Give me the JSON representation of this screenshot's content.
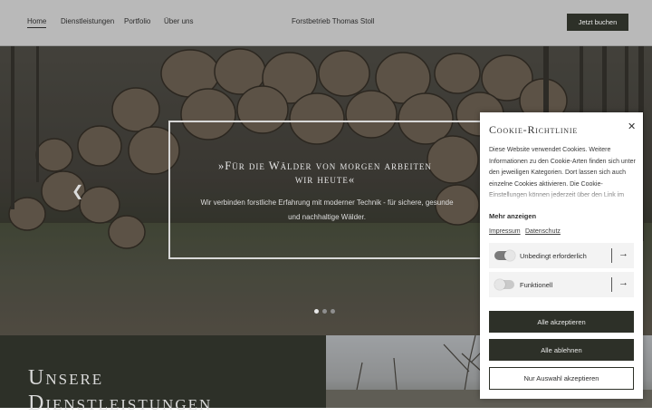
{
  "header": {
    "nav": [
      "Home",
      "Dienstleistungen",
      "Portfolio",
      "Über uns"
    ],
    "brand": "Forstbetrieb Thomas Stoll",
    "book_button": "Jetzt buchen"
  },
  "hero": {
    "quote_title_line1": "»Für die Wälder von morgen arbeiten",
    "quote_title_line2": "wir heute«",
    "quote_text": "Wir verbinden forstliche Erfahrung mit moderner Technik - für sichere, gesunde und nachhaltige Wälder.",
    "prev_icon": "chevron-left-icon",
    "slides_total": 3,
    "slide_active": 1
  },
  "services": {
    "heading_line1": "Unsere",
    "heading_line2": "Dienstleistungen"
  },
  "cookie": {
    "title": "Cookie-Richtlinie",
    "close_icon": "close-icon",
    "body": "Diese Website verwendet Cookies. Weitere Informationen zu den Cookie-Arten finden sich unter den jeweiligen Kategorien. Dort lassen sich auch einzelne Cookies aktivieren. Die Cookie-Einstellungen können jederzeit über den Link im Footer dieser",
    "show_more": "Mehr anzeigen",
    "links": [
      "Impressum",
      "Datenschutz"
    ],
    "toggles": [
      {
        "label": "Unbedingt erforderlich",
        "on": true
      },
      {
        "label": "Funktionell",
        "on": false
      }
    ],
    "accept_all": "Alle akzeptieren",
    "reject_all": "Alle ablehnen",
    "accept_selection": "Nur Auswahl akzeptieren"
  },
  "colors": {
    "dark_green": "#2d3028",
    "header_bg": "#b9b9b9"
  }
}
